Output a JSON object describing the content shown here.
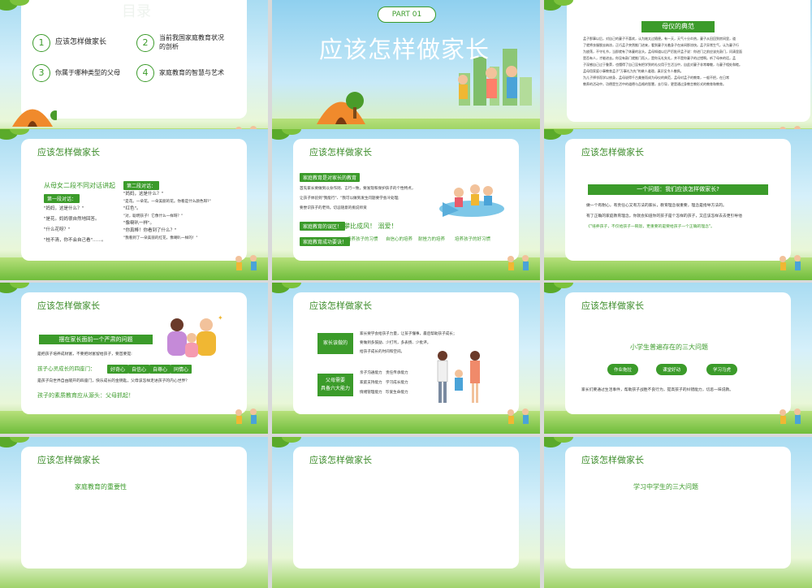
{
  "s1": {
    "watermark": "目录",
    "items": [
      {
        "num": "1",
        "label": "应该怎样做家长"
      },
      {
        "num": "2",
        "label": "当前我国家庭教育状况",
        "label2": "的剖析"
      },
      {
        "num": "3",
        "label": "你属于哪种类型的父母"
      },
      {
        "num": "4",
        "label": "家庭教育的智慧与艺术"
      }
    ]
  },
  "s2": {
    "part": "PART 01",
    "title": "应该怎样做家长"
  },
  "s3": {
    "title": "母仪的典范",
    "lines": [
      "孟子那事以后，对自己的妻子不喜欢，认为她太过随便。有一天，天气十分炎热，妻子从田回到房间里，道",
      "了就将衣服脱去纳凉，正巧孟子突然推门进来，看到妻子光着身子在床间那凉快。孟子异常生气，认为妻子行",
      "为放荡，不守礼节，当即就有了休妻的念头。孟母知道以后严厉批评孟子说：你进门之前应该先敲门，问清里面",
      "是否有人，才能进去。你没有敲门就推门而入，是你无礼失礼，并不是你妻子的过错啊。听了母亲的话，孟",
      "子深感自己过于鲁莽，也懂得了自己没有把学到的礼仪用于生活当中，自此对妻子非常尊敬，与妻子相处和睦。",
      "孟母用家庭小事教育孟子\"万事礼为先\"的做人道理，真识见令人敬佩。",
      "为儿子择邻而学以修身，孟母说得千古美誉而成为母仪的典范，孟母对孟子的教育，一般不把，在日常",
      "教养的活动中，功德是生活中的道德与品格的智慧，去引导，更是通过身教言教形式的教育和教育。"
    ]
  },
  "s4": {
    "header": "应该怎样做家长",
    "subtitle": "从母女二段不同对话讲起",
    "tag1": "第一段对话：",
    "tag2": "第二段对话：",
    "left": [
      "\"妈妈，这是什么？\"",
      "\"是花。妈妈很自然地回答。",
      "\"什么花呀？\"",
      "\"桂不清，你不会自己看\"……。"
    ],
    "right": [
      "\"妈妈，这是什么？\"",
      "\"是花。一朵花。一朵美丽的花。你看是什么颜色呀?\"",
      "\"红色\"。",
      "\"对，聪明孩子！它像什么一样呀？\"",
      "\"像喇叭一样\"。",
      "\"你真棒！你看到了什么？\"",
      "\"我看到了一朵美丽的红花，像喇叭一样的！\""
    ]
  },
  "s5": {
    "header": "应该怎样做家长",
    "tag1": "家庭教育是对家长的教育",
    "lines": [
      "首先家长要做到以身作则、言行一致，要发现和保护孩子的个性特点，",
      "让孩子体验到\"我能行\"、\"我可以做到发生问题要学会冷处理;",
      "要尝识孩子的老师。切忌随意的挑说师资"
    ],
    "tag2": "家庭教育的误区！",
    "slogan": "攀比成风！ 溺爱！",
    "tag3": "家庭教育成功要诀！",
    "keys": [
      "培养孩子的习惯",
      "自信心的培养",
      "耐挫力的培养",
      "培养孩子的好习惯"
    ]
  },
  "s6": {
    "header": "应该怎样做家长",
    "banner": "一个问题：我们应该怎样做家长?",
    "lines": [
      "做一个有耐心，有责任心又有方法的家长，教育理念很重要，理念是指导方法的。",
      "有了正确的家庭教育理念，你就会知道你的孩子是个怎样的孩子，又应该怎样去去更引导他",
      "《\"培养孩子，不仅给孩子一碗饭，更重要的是要给孩子一个正确的理念\"。"
    ]
  },
  "s7": {
    "header": "应该怎样做家长",
    "banner": "摆在家长面前一个严肃的问题",
    "line1": "是把孩子培养成财富，不要把财富留给孩子，要首要提:",
    "key": "孩子心灵成长的四座门：",
    "doors": [
      "好奇心",
      "自信心",
      "自尊心",
      "同情心"
    ],
    "line2": "是孩子向世界自由敞开的四座门，快乐成长的金钥匙，父母该怎样走进孩子的内心世界？",
    "slogan": "孩子的素质教育应从源头：父母抓起！"
  },
  "s8": {
    "header": "应该怎样做家长",
    "tag1": "家长该做的",
    "lines1": [
      "家长要学会给孩子力量，让孩子懂事，最后帮助孩子成长；",
      "要做到多鼓励、少打骂，多表扬、少批评。",
      "给孩子成长的时间和空间。"
    ],
    "tag2a": "父母需要",
    "tag2b": "具备六大能力",
    "abilities": [
      [
        "亲子沟通能力",
        "责任传承能力"
      ],
      [
        "家庭支持能力",
        "学习成长能力"
      ],
      [
        "情绪管理能力",
        "珍爱生命能力"
      ]
    ]
  },
  "s9": {
    "header": "应该怎样做家长",
    "title": "小学生普遍存在的三大问题",
    "pills": [
      "作业拖拉",
      "课堂好动",
      "学习马虎"
    ],
    "line": "家长们要通过生活事件，帮助孩子战胜不良行为，提高孩子的纠错能力，切忌一味说教。"
  },
  "s10": {
    "header": "应该怎样做家长",
    "partial": "家庭教育的重要性"
  },
  "s11": {
    "header": "应该怎样做家长"
  },
  "s12": {
    "header": "应该怎样做家长",
    "partial": "学习中学生的三大问题"
  },
  "colors": {
    "green": "#3b9b2a",
    "title_green": "#3c8c2a",
    "sky": "#a9dcf2"
  }
}
